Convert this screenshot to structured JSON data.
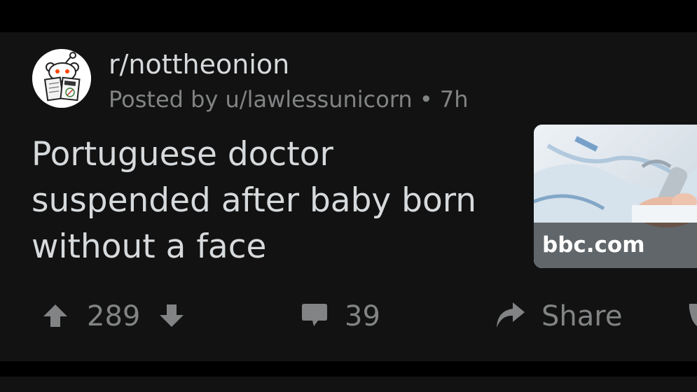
{
  "post": {
    "subreddit": "r/nottheonion",
    "posted_by": "Posted by u/lawlessunicorn",
    "separator": "•",
    "age": "7h",
    "title": "Portuguese doctor suspended after baby born without a face",
    "link_domain": "bbc.com"
  },
  "actions": {
    "score": "289",
    "comments": "39",
    "share_label": "Share"
  },
  "icons": {
    "upvote": "upvote-arrow-icon",
    "downvote": "downvote-arrow-icon",
    "comment": "comment-bubble-icon",
    "share": "share-arrow-icon",
    "award": "award-icon"
  },
  "colors": {
    "background": "#000000",
    "card": "#121212",
    "primary_text": "#d7dadc",
    "secondary_text": "#818384"
  }
}
